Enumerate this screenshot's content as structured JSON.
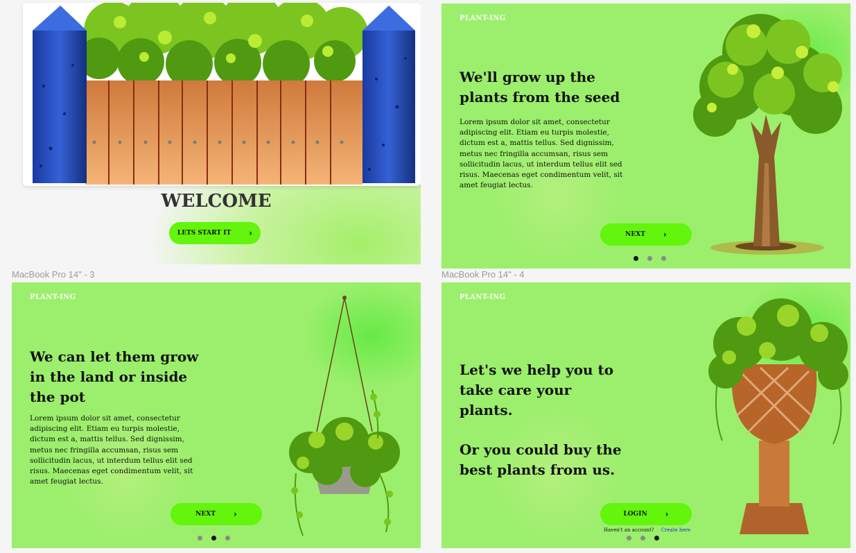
{
  "frames": {
    "welcome": {
      "title": "WELCOME",
      "button_label": "LETS START IT"
    },
    "seed": {
      "brand": "PLANT-ING",
      "headline": "We'll grow up the plants from the seed",
      "body": "Lorem ipsum dolor sit amet, consectetur adipiscing elit. Etiam eu turpis molestie, dictum est a, mattis tellus. Sed dignissim, metus nec fringilla accumsan, risus sem sollicitudin lacus, ut interdum tellus elit sed risus. Maecenas eget condimentum velit, sit amet feugiat lectus.",
      "button_label": "NEXT"
    },
    "pot": {
      "label": "MacBook Pro 14\" - 3",
      "brand": "PLANT-ING",
      "headline": "We can let them grow in the land or inside the pot",
      "body": "Lorem ipsum dolor sit amet, consectetur adipiscing elit. Etiam eu turpis molestie, dictum est a, mattis tellus. Sed dignissim, metus nec fringilla accumsan, risus sem sollicitudin lacus, ut interdum tellus elit sed risus. Maecenas eget condimentum velit, sit amet feugiat lectus.",
      "button_label": "NEXT"
    },
    "login": {
      "label": "MacBook Pro 14\" - 4",
      "brand": "PLANT-ING",
      "headline1": "Let's we help you to take care your plants.",
      "headline2": "Or you could buy the best plants from us.",
      "button_label": "LOGIN",
      "no_account": "Haven't an account?",
      "create_link": "Create here"
    }
  },
  "pagination": {
    "seed": {
      "total": 3,
      "active": 1
    },
    "pot": {
      "total": 3,
      "active": 2
    },
    "login": {
      "total": 3,
      "active": 3
    }
  },
  "icons": {
    "chevron": "chevron-right-icon"
  },
  "colors": {
    "page_background": "#f5f5f5",
    "frame_green": "#9bef6c",
    "button_green": "#63f50c",
    "fence_post_blue": "#1c3fa8",
    "fence_wood": "#e3934f",
    "link_blue": "#1a2fd6"
  }
}
